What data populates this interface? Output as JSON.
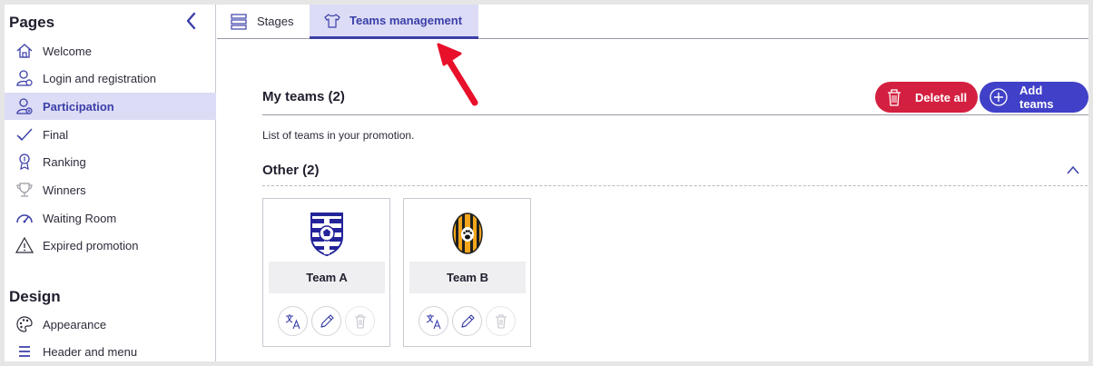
{
  "sidebar": {
    "pages_heading": "Pages",
    "design_heading": "Design",
    "items": [
      {
        "label": "Welcome",
        "icon": "home-icon"
      },
      {
        "label": "Login and registration",
        "icon": "user-settings-icon"
      },
      {
        "label": "Participation",
        "icon": "user-add-icon"
      },
      {
        "label": "Final",
        "icon": "checkmark-icon"
      },
      {
        "label": "Ranking",
        "icon": "medal-icon"
      },
      {
        "label": "Winners",
        "icon": "trophy-icon"
      },
      {
        "label": "Waiting Room",
        "icon": "speedometer-icon"
      },
      {
        "label": "Expired promotion",
        "icon": "warning-icon"
      }
    ],
    "design_items": [
      {
        "label": "Appearance",
        "icon": "palette-icon"
      },
      {
        "label": "Header and menu",
        "icon": "menu-icon"
      }
    ]
  },
  "tabs": [
    {
      "label": "Stages",
      "icon": "list-icon"
    },
    {
      "label": "Teams management",
      "icon": "jersey-icon"
    }
  ],
  "my_teams": {
    "title": "My teams (2)",
    "description": "List of teams in your promotion.",
    "delete_all_label": "Delete all",
    "add_teams_label": "Add teams"
  },
  "group": {
    "title": "Other (2)"
  },
  "teams": [
    {
      "name": "Team A",
      "logo": "blue-white-striped-shield-with-soccer-ball"
    },
    {
      "name": "Team B",
      "logo": "orange-black-striped-oval-with-paw"
    }
  ],
  "colors": {
    "accent": "#3b3fa8",
    "accent_light": "#dcdcf6",
    "danger": "#d42040",
    "primary_button": "#4040c8",
    "arrow": "#e8102a"
  }
}
